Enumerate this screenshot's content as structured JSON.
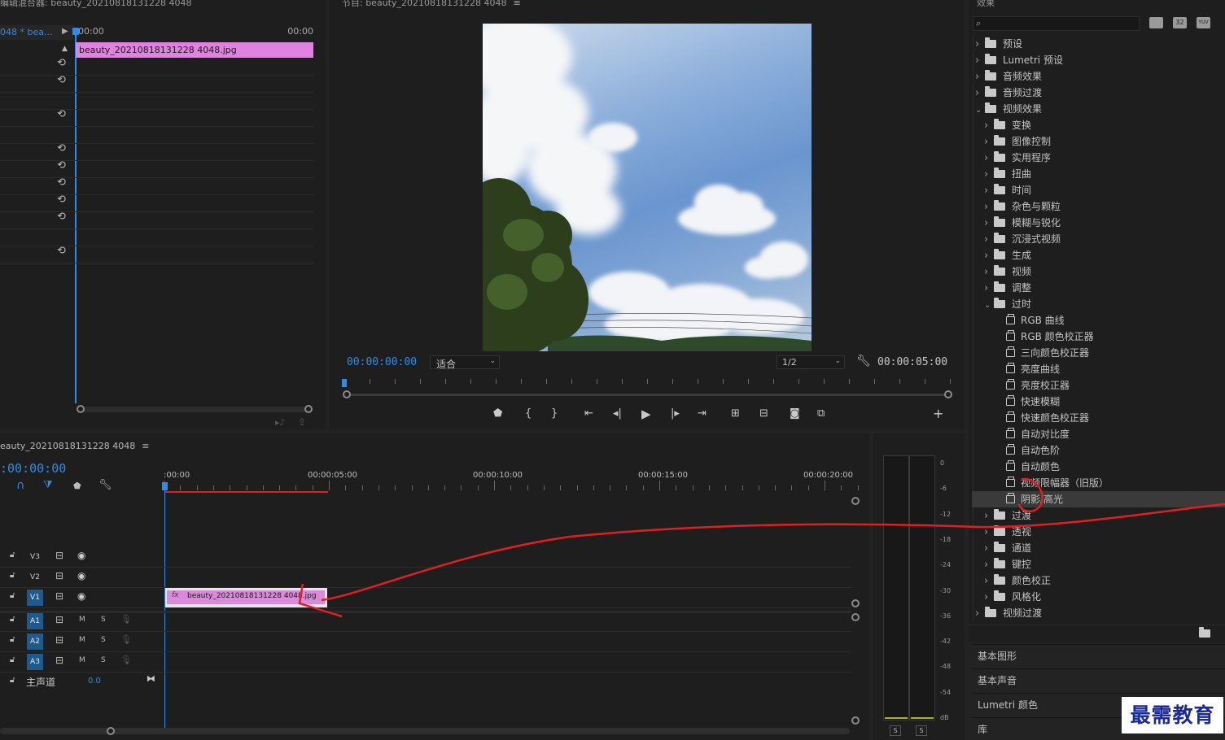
{
  "effect_controls": {
    "title": "编辑混合器: beauty_20210818131228 4048",
    "clip_selector": "048 * bea...",
    "time_start": "00:00",
    "time_end": "00:00",
    "clip_label": "beauty_20210818131228 4048.jpg"
  },
  "program": {
    "title": "节目: beauty_20210818131228 4048",
    "timecode_left": "00:00:00:00",
    "fit_label": "适合",
    "res_label": "1/2",
    "timecode_right": "00:00:05:00"
  },
  "sequence": {
    "title": "eauty_20210818131228 4048",
    "timecode": ":00:00:00",
    "ruler_labels": [
      ":00:00",
      "00:00:05:00",
      "00:00:10:00",
      "00:00:15:00",
      "00:00:20:00"
    ],
    "clip_label": "beauty_20210818131228 4048.jpg",
    "tracks": [
      {
        "name": "V3",
        "type": "video"
      },
      {
        "name": "V2",
        "type": "video"
      },
      {
        "name": "V1",
        "type": "video",
        "active": true
      },
      {
        "name": "A1",
        "type": "audio"
      },
      {
        "name": "A2",
        "type": "audio"
      },
      {
        "name": "A3",
        "type": "audio"
      }
    ],
    "master_label": "主声道",
    "master_value": "0.0",
    "m_label": "M",
    "s_label": "S"
  },
  "meters": {
    "scale": [
      "0",
      "-6",
      "-12",
      "-18",
      "-24",
      "-30",
      "-36",
      "-42",
      "-48",
      "-54",
      "dB"
    ],
    "solo_left": "S",
    "solo_right": "S"
  },
  "effects_panel": {
    "title": "效果",
    "items": [
      {
        "label": "预设",
        "level": 0,
        "kind": "folder-star",
        "expanded": false
      },
      {
        "label": "Lumetri 预设",
        "level": 0,
        "kind": "folder-star",
        "expanded": false
      },
      {
        "label": "音频效果",
        "level": 0,
        "kind": "folder",
        "expanded": false
      },
      {
        "label": "音频过渡",
        "level": 0,
        "kind": "folder",
        "expanded": false
      },
      {
        "label": "视频效果",
        "level": 0,
        "kind": "folder",
        "expanded": true
      },
      {
        "label": "变换",
        "level": 1,
        "kind": "folder",
        "expanded": false
      },
      {
        "label": "图像控制",
        "level": 1,
        "kind": "folder",
        "expanded": false
      },
      {
        "label": "实用程序",
        "level": 1,
        "kind": "folder",
        "expanded": false
      },
      {
        "label": "扭曲",
        "level": 1,
        "kind": "folder",
        "expanded": false
      },
      {
        "label": "时间",
        "level": 1,
        "kind": "folder",
        "expanded": false
      },
      {
        "label": "杂色与颗粒",
        "level": 1,
        "kind": "folder",
        "expanded": false
      },
      {
        "label": "模糊与锐化",
        "level": 1,
        "kind": "folder",
        "expanded": false
      },
      {
        "label": "沉浸式视频",
        "level": 1,
        "kind": "folder",
        "expanded": false
      },
      {
        "label": "生成",
        "level": 1,
        "kind": "folder",
        "expanded": false
      },
      {
        "label": "视频",
        "level": 1,
        "kind": "folder",
        "expanded": false
      },
      {
        "label": "调整",
        "level": 1,
        "kind": "folder",
        "expanded": false
      },
      {
        "label": "过时",
        "level": 1,
        "kind": "folder",
        "expanded": true
      },
      {
        "label": "RGB 曲线",
        "level": 2,
        "kind": "effect"
      },
      {
        "label": "RGB 颜色校正器",
        "level": 2,
        "kind": "effect"
      },
      {
        "label": "三向颜色校正器",
        "level": 2,
        "kind": "effect"
      },
      {
        "label": "亮度曲线",
        "level": 2,
        "kind": "effect"
      },
      {
        "label": "亮度校正器",
        "level": 2,
        "kind": "effect"
      },
      {
        "label": "快速模糊",
        "level": 2,
        "kind": "effect"
      },
      {
        "label": "快速颜色校正器",
        "level": 2,
        "kind": "effect"
      },
      {
        "label": "自动对比度",
        "level": 2,
        "kind": "effect"
      },
      {
        "label": "自动色阶",
        "level": 2,
        "kind": "effect"
      },
      {
        "label": "自动颜色",
        "level": 2,
        "kind": "effect"
      },
      {
        "label": "视频限幅器（旧版）",
        "level": 2,
        "kind": "effect"
      },
      {
        "label": "阴影/高光",
        "level": 2,
        "kind": "effect",
        "selected": true
      },
      {
        "label": "过渡",
        "level": 1,
        "kind": "folder",
        "expanded": false
      },
      {
        "label": "透视",
        "level": 1,
        "kind": "folder",
        "expanded": false
      },
      {
        "label": "通道",
        "level": 1,
        "kind": "folder",
        "expanded": false
      },
      {
        "label": "键控",
        "level": 1,
        "kind": "folder",
        "expanded": false
      },
      {
        "label": "颜色校正",
        "level": 1,
        "kind": "folder",
        "expanded": false
      },
      {
        "label": "风格化",
        "level": 1,
        "kind": "folder",
        "expanded": false
      },
      {
        "label": "视频过渡",
        "level": 0,
        "kind": "folder",
        "expanded": false
      }
    ],
    "badge_labels": [
      "32",
      "YUV"
    ]
  },
  "bottom_panels": [
    "基本图形",
    "基本声音",
    "Lumetri 颜色",
    "库"
  ],
  "watermark": "最需教育",
  "colors": {
    "accent_blue": "#2d8ceb",
    "clip_pink": "#e083e0",
    "annotation_red": "#e02020",
    "track_active": "#1f5a8d"
  }
}
